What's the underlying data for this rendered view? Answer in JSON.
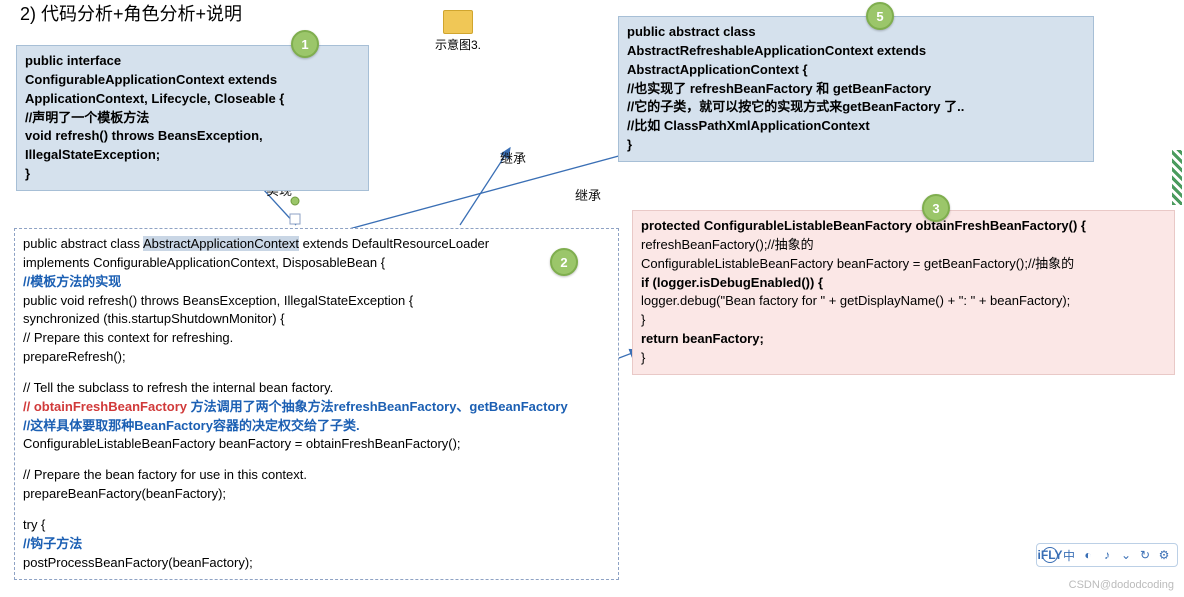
{
  "title": "2)  代码分析+角色分析+说明",
  "folderLabel": "示意图3.",
  "labels": {
    "impl": "实现",
    "inh1": "继承",
    "inh2": "继承"
  },
  "badges": {
    "b1": "1",
    "b2": "2",
    "b3": "3",
    "b5": "5"
  },
  "box1": {
    "l1": "public interface",
    "l2": "ConfigurableApplicationContext extends",
    "l3": "ApplicationContext, Lifecycle, Closeable {",
    "l4": "//声明了一个模板方法",
    "l5": "void refresh() throws BeansException,",
    "l6": "IllegalStateException;",
    "l7": "}"
  },
  "box5": {
    "l1": "public abstract class",
    "l2": "AbstractRefreshableApplicationContext extends",
    "l3": "AbstractApplicationContext {",
    "l4": "//也实现了 refreshBeanFactory 和 getBeanFactory",
    "l5": "//它的子类，就可以按它的实现方式来getBeanFactory 了..",
    "l6": "//比如 ClassPathXmlApplicationContext",
    "l7": "}"
  },
  "box2": {
    "l1a": "public abstract class ",
    "l1b": "AbstractApplicationContext",
    "l1c": " extends DefaultResourceLoader",
    "l2": "implements ConfigurableApplicationContext, DisposableBean {",
    "l3": "//模板方法的实现",
    "l4": "public void refresh() throws BeansException, IllegalStateException {",
    "l5": "synchronized (this.startupShutdownMonitor) {",
    "l6": "// Prepare this context for refreshing.",
    "l7": "prepareRefresh();",
    "l8": "// Tell the subclass to refresh the internal bean factory.",
    "l9a": "// obtainFreshBeanFactory ",
    "l9b": "方法调用了两个抽象方法refreshBeanFactory、getBeanFactory",
    "l10": "//这样具体要取那种BeanFactory容器的决定权交给了子类.",
    "l11": "ConfigurableListableBeanFactory beanFactory = obtainFreshBeanFactory();",
    "l12": "// Prepare the bean factory for use in this context.",
    "l13": "prepareBeanFactory(beanFactory);",
    "l14": "try {",
    "l15": "//钩子方法",
    "l16": "postProcessBeanFactory(beanFactory);"
  },
  "box3": {
    "l1": "protected ConfigurableListableBeanFactory obtainFreshBeanFactory() {",
    "l2": "refreshBeanFactory();//抽象的",
    "l3": "ConfigurableListableBeanFactory beanFactory = getBeanFactory();//抽象的",
    "l4": "if (logger.isDebugEnabled()) {",
    "l5": "logger.debug(\"Bean factory for \" + getDisplayName() + \": \" + beanFactory);",
    "l6": "}",
    "l7": "return beanFactory;",
    "l8": "}"
  },
  "toolbar": {
    "t1": "中",
    "t2": "◐",
    "t3": "♪",
    "t4": "⌄",
    "t5": "↻",
    "t6": "⚙"
  },
  "watermark": "CSDN@dododcoding"
}
